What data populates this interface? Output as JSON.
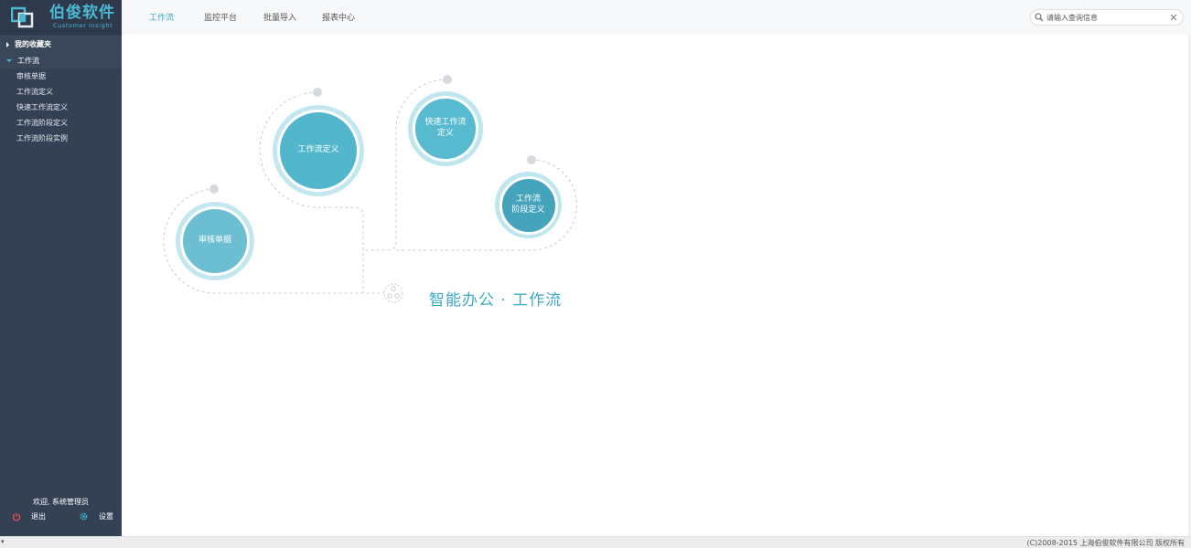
{
  "app": {
    "title": "伯俊软件",
    "subtitle": "Customer Insight"
  },
  "sidebar": {
    "favorites_label": "我的收藏夹",
    "workflow_label": "工作流",
    "items": [
      {
        "label": "审核单据"
      },
      {
        "label": "工作流定义"
      },
      {
        "label": "快速工作流定义"
      },
      {
        "label": "工作流阶段定义"
      },
      {
        "label": "工作流阶段实例"
      }
    ],
    "welcome": "欢迎, 系统管理员",
    "logout_label": "退出",
    "settings_label": "设置"
  },
  "topnav": {
    "tabs": [
      {
        "label": "工作流",
        "active": true
      },
      {
        "label": "监控平台",
        "active": false
      },
      {
        "label": "批量导入",
        "active": false
      },
      {
        "label": "报表中心",
        "active": false
      }
    ]
  },
  "search": {
    "placeholder": "请输入查询信息",
    "value": ""
  },
  "diagram": {
    "nodes": [
      {
        "label_line1": "审核单据",
        "label_line2": ""
      },
      {
        "label_line1": "工作流定义",
        "label_line2": ""
      },
      {
        "label_line1": "快速工作流",
        "label_line2": "定义"
      },
      {
        "label_line1": "工作流",
        "label_line2": "阶段定义"
      }
    ],
    "banner": "智能办公 · 工作流"
  },
  "footer": {
    "copyright": "(C)2008-2015 上海伯俊软件有限公司 版权所有",
    "corner_mark": "▾"
  },
  "colors": {
    "sidebar_bg": "#344154",
    "accent": "#3ba9c8",
    "node_outer": "#b9e3ee",
    "node_inner": "#52b6cc"
  },
  "icons": [
    "logo-icon",
    "caret-right-icon",
    "caret-down-icon",
    "power-icon",
    "gear-icon",
    "search-icon",
    "close-icon",
    "workflow-hub-icon"
  ]
}
